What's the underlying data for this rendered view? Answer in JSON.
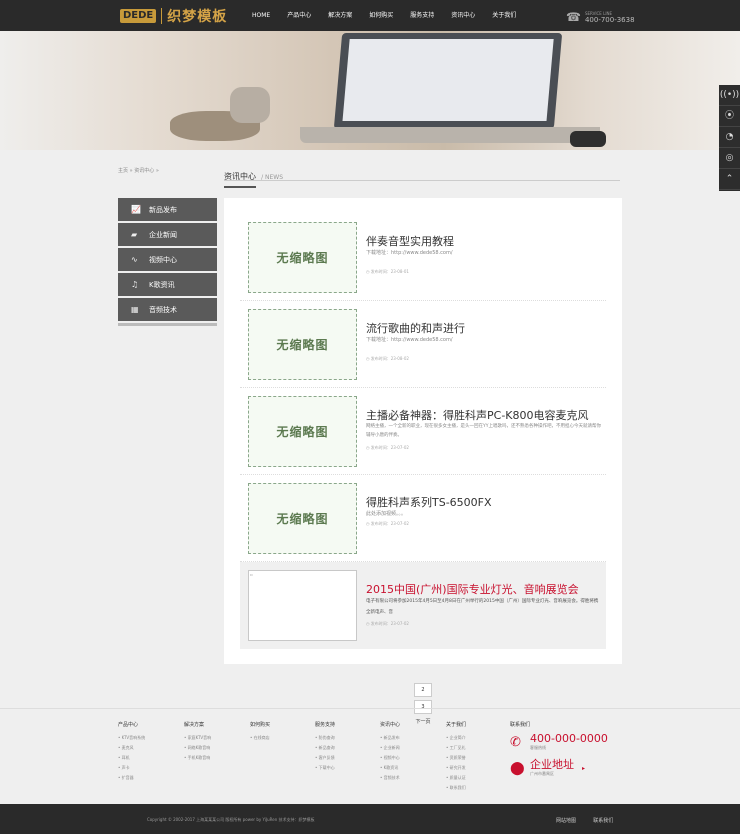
{
  "header": {
    "logo_mark": "DEDE",
    "brand": "织梦模板",
    "nav": [
      "HOME",
      "产品中心",
      "解决方案",
      "如何购买",
      "服务支持",
      "资讯中心",
      "关于我们"
    ],
    "service_label": "SERVICE LINE",
    "service_phone": "400-700-3638"
  },
  "side_tools": [
    "wifi-icon",
    "location-icon",
    "qq-icon",
    "wechat-icon",
    "top-icon"
  ],
  "breadcrumb": "主页 » 资讯中心 »",
  "page_title": "资讯中心",
  "page_title_en": "/ NEWS",
  "menu": [
    {
      "label": "新品发布",
      "icon": "chart-icon"
    },
    {
      "label": "企业新闻",
      "icon": "folder-icon"
    },
    {
      "label": "视频中心",
      "icon": "wave-icon"
    },
    {
      "label": "K歌资讯",
      "icon": "music-icon"
    },
    {
      "label": "音频技术",
      "icon": "film-icon"
    }
  ],
  "news": [
    {
      "thumb": "无缩略图",
      "title": "伴奏音型实用教程",
      "desc": "下载地址：http://www.dede58.com/",
      "time": "发布时间：23-08-01",
      "highlight": false
    },
    {
      "thumb": "无缩略图",
      "title": "流行歌曲的和声进行",
      "desc": "下载地址：http://www.dede58.com/",
      "time": "发布时间：23-08-02",
      "highlight": false
    },
    {
      "thumb": "无缩略图",
      "title": "主播必备神器：得胜科声PC-K800电容麦克风",
      "desc": "网络主播，一个全新的职业，现在很多女主播，是头一回在YY上唱歌吗，还不熟悉各种操作吧，不用担心今天就请帮你辅导小唐的伴奏。",
      "time": "发布时间：23-07-02",
      "highlight": false
    },
    {
      "thumb": "无缩略图",
      "title": "得胜科声系列TS-6500FX",
      "desc": "此处添加视频。。。",
      "time": "发布时间：23-07-02",
      "highlight": false
    },
    {
      "thumb": "",
      "title": "2015中国(广州)国际专业灯光、音响展览会",
      "desc": "电子有限公司将参加2015年4月5日至4月8日在广州举行的2015中国（广州）国际专业灯光、音响展览会。得胜将携全新电声、音",
      "time": "发布时间：23-07-02",
      "highlight": true
    }
  ],
  "pager": [
    "2",
    "3",
    "下一页"
  ],
  "footer": {
    "columns": [
      {
        "title": "产品中心",
        "links": [
          "KTV音响系统",
          "麦克风",
          "耳机",
          "声卡",
          "扩音器"
        ]
      },
      {
        "title": "解决方案",
        "links": [
          "家庭KTV音响",
          "网络K歌音响",
          "手机K歌音响"
        ]
      },
      {
        "title": "如何购买",
        "links": [
          "在线商店"
        ]
      },
      {
        "title": "服务支持",
        "links": [
          "防伪查询",
          "新品查询",
          "客户反馈",
          "下载中心"
        ]
      },
      {
        "title": "资讯中心",
        "links": [
          "新品发布",
          "企业新闻",
          "视频中心",
          "K歌资讯",
          "音频技术"
        ]
      },
      {
        "title": "关于我们",
        "links": [
          "企业简介",
          "工厂见礼",
          "资质荣誉",
          "研究开发",
          "质量认证",
          "联系我们"
        ]
      }
    ],
    "contact_title": "联系我们",
    "phone": "400-000-0000",
    "phone_label": "客服热线",
    "address_title": "企业地址",
    "address": "广州市番禺区",
    "copyright": "Copyright © 2002-2017 上海某某某公司 版权所有 power by YiJuRen  技术支持：织梦模板",
    "links": [
      "网站地图",
      "联系我们"
    ]
  }
}
